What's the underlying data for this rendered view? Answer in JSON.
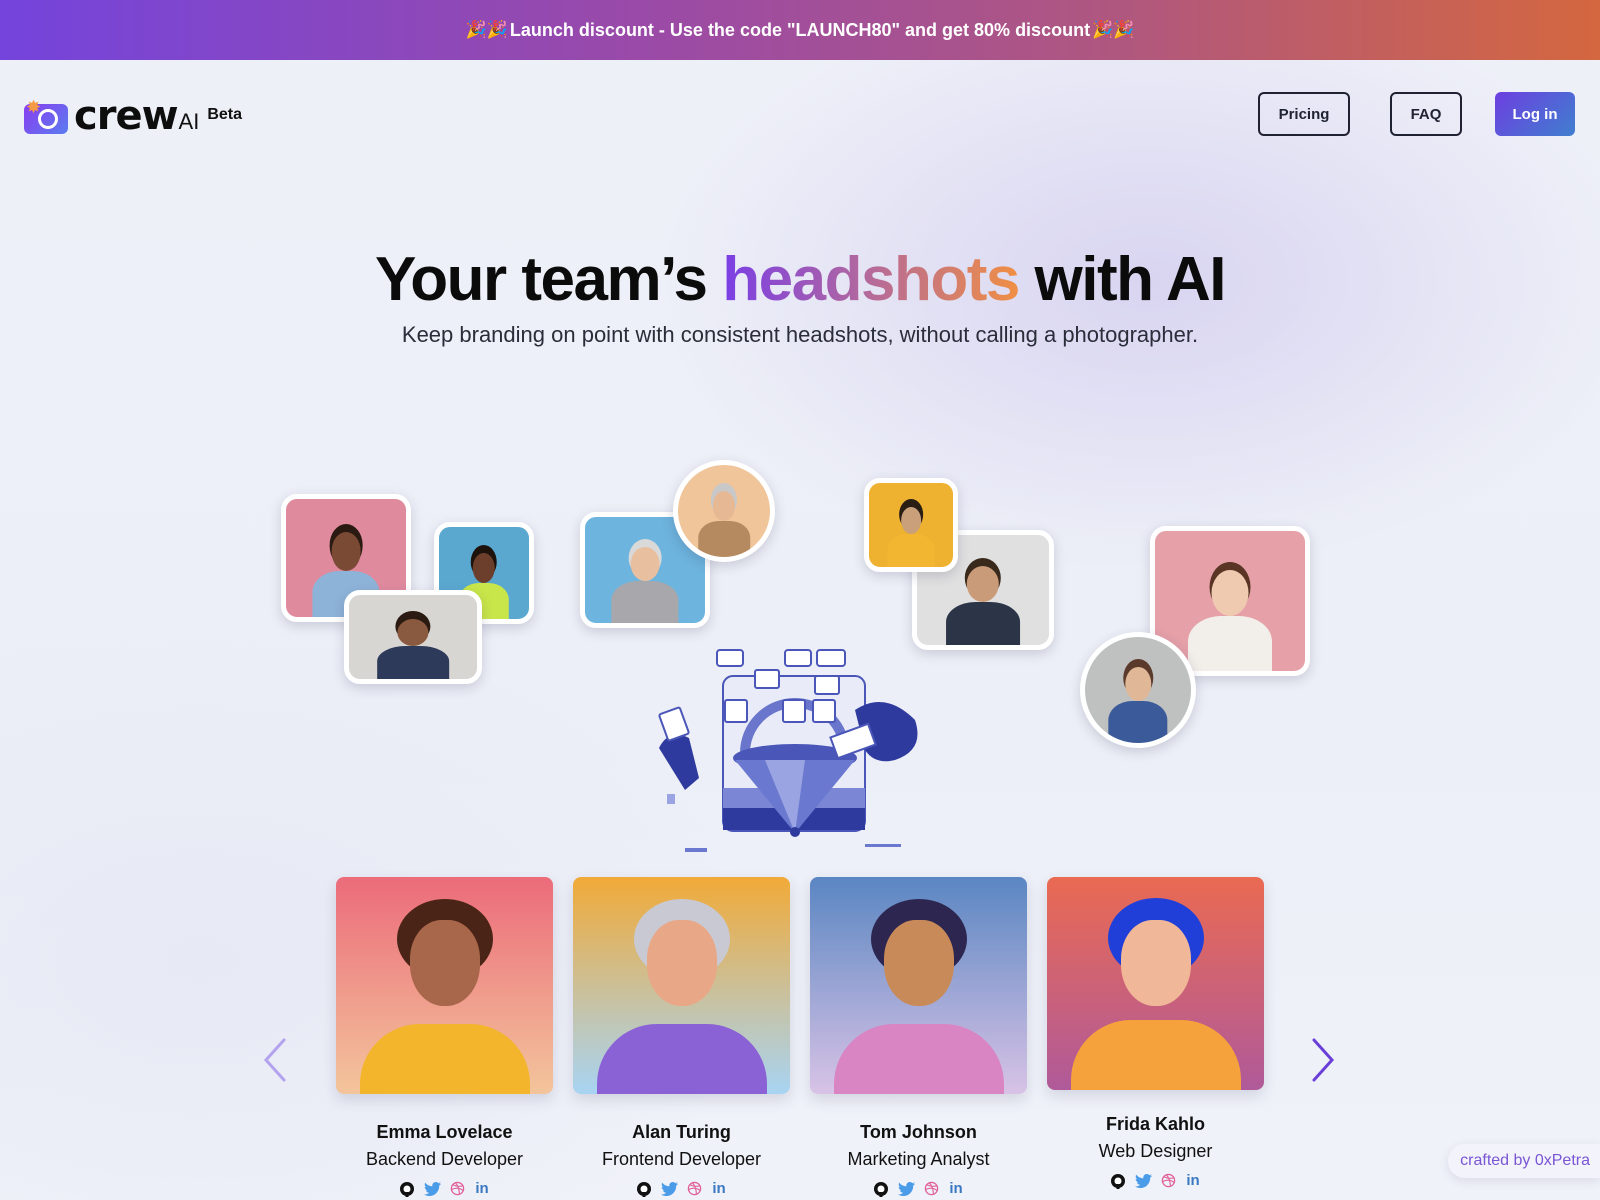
{
  "banner": {
    "emoji_left": "🎉🎉",
    "text": "Launch discount - Use the code \"LAUNCH80\" and get 80% discount",
    "emoji_right": "🎉🎉"
  },
  "header": {
    "logo_word": "crew",
    "logo_suffix": "AI",
    "logo_badge": "Beta",
    "nav": {
      "pricing": "Pricing",
      "faq": "FAQ",
      "login": "Log in"
    }
  },
  "hero": {
    "title_before": "Your team’s ",
    "title_highlight": "headshots",
    "title_after": " with AI",
    "subtitle": "Keep branding on point with consistent headshots, without calling a photographer."
  },
  "collage": {
    "photos": [
      {
        "label": "woman-laughing-pink",
        "bg": "#e08a9e",
        "skin": "#7a4a35",
        "hair": "#2b1a12",
        "top": "#8eb3d8"
      },
      {
        "label": "woman-smiling-blue",
        "bg": "#5aa8d0",
        "skin": "#6b3f2b",
        "hair": "#1d120c",
        "top": "#c8e64a"
      },
      {
        "label": "woman-reading-floor",
        "bg": "#d8d6d2",
        "skin": "#8a5a40",
        "hair": "#2a1a12",
        "top": "#2d3a5a"
      },
      {
        "label": "older-man-phone",
        "bg": "#6db4de",
        "skin": "#e8c0a0",
        "hair": "#d9d9d9",
        "top": "#a8a8ac"
      },
      {
        "label": "older-man-pointing",
        "bg": "#f1c59a",
        "skin": "#e6b894",
        "hair": "#c8c8c8",
        "top": "#b58a60"
      },
      {
        "label": "man-yellow-shirt",
        "bg": "#eeb230",
        "skin": "#caa07a",
        "hair": "#2a1d14",
        "top": "#f3b630"
      },
      {
        "label": "man-shrugging",
        "bg": "#e0e0e0",
        "skin": "#c99b78",
        "hair": "#3a2a1c",
        "top": "#2c3548"
      },
      {
        "label": "woman-pointing-pink",
        "bg": "#e5a0a8",
        "skin": "#efcab0",
        "hair": "#5a3424",
        "top": "#f2efea"
      },
      {
        "label": "woman-studying-couch",
        "bg": "#bfc0c0",
        "skin": "#e0b898",
        "hair": "#5a3a2a",
        "top": "#3b5a9a"
      }
    ]
  },
  "team": {
    "members": [
      {
        "name": "Emma Lovelace",
        "role": "Backend Developer",
        "bg_top": "#ec6b7a",
        "bg_bottom": "#f3c59c",
        "skin": "#a8674a",
        "hair": "#4a2416",
        "top": "#f2b52c"
      },
      {
        "name": "Alan Turing",
        "role": "Frontend Developer",
        "bg_top": "#f1aa38",
        "bg_bottom": "#a8d4f3",
        "skin": "#e8a888",
        "hair": "#c9c9d4",
        "top": "#8b62d6"
      },
      {
        "name": "Tom Johnson",
        "role": "Marketing Analyst",
        "bg_top": "#5a86c2",
        "bg_bottom": "#d8c3e6",
        "skin": "#c98a5a",
        "hair": "#2d2650",
        "top": "#d985c4"
      },
      {
        "name": "Frida Kahlo",
        "role": "Web Designer",
        "bg_top": "#ea6a52",
        "bg_bottom": "#b05a9a",
        "skin": "#f0b898",
        "hair": "#1f3fd8",
        "top": "#f5a23c"
      }
    ],
    "social_icons": [
      "github-icon",
      "twitter-icon",
      "dribbble-icon",
      "linkedin-icon"
    ],
    "social_glyphs": {
      "linkedin": "in"
    }
  },
  "carousel": {
    "prev_icon": "chevron-left-icon",
    "next_icon": "chevron-right-icon"
  },
  "footer": {
    "crafted": "crafted by 0xPetra"
  },
  "colors": {
    "brand_purple": "#7444dc",
    "brand_orange": "#d4673f",
    "login_gradient_start": "#6d3fe0",
    "login_gradient_end": "#3f7fcf",
    "twitter": "#4a9be8",
    "dribbble": "#e0609a",
    "linkedin": "#3a78c2",
    "arrow": "#6a3fd8"
  }
}
